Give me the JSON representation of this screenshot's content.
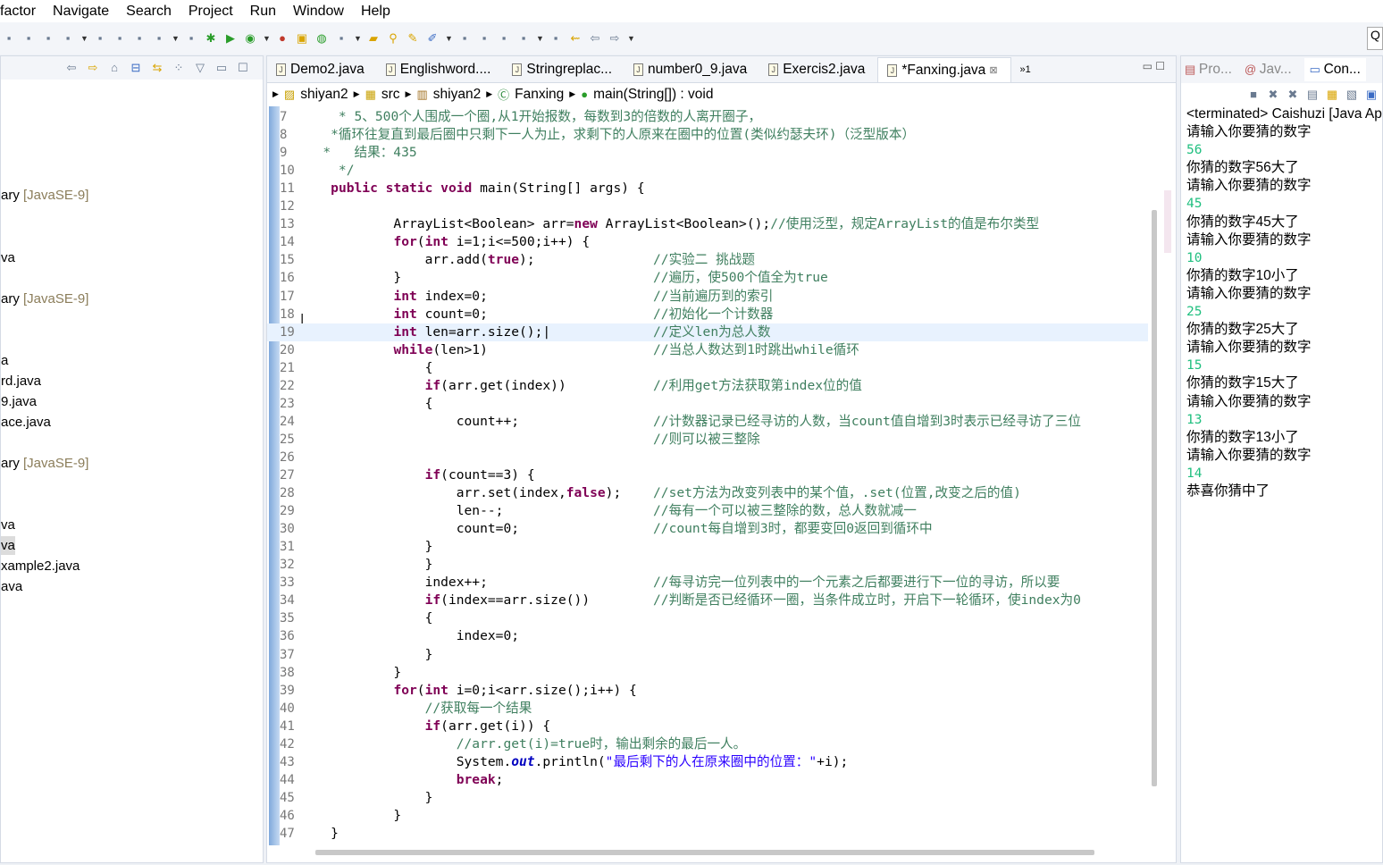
{
  "menu": [
    "factor",
    "Navigate",
    "Search",
    "Project",
    "Run",
    "Window",
    "Help"
  ],
  "toolbar": {
    "icons": [
      "skip-icon",
      "suspend-icon",
      "terminate-icon",
      "disconnect-icon",
      "step-into-icon",
      "step-over-icon",
      "step-return-icon",
      "toggle-icon",
      "build-icon",
      "debug-icon",
      "run-icon",
      "coverage-icon",
      "external-tools-icon",
      "new-package-icon",
      "new-class-icon",
      "open-type-icon",
      "open-folder-icon",
      "search-icon",
      "mark-occurrences-icon",
      "highlight-icon",
      "block-select-icon",
      "whitespace-icon",
      "pilcrow-icon",
      "next-annotation-icon",
      "prev-annotation-icon",
      "last-edit-icon",
      "back-icon",
      "forward-icon"
    ],
    "search_placeholder": "Q"
  },
  "left": {
    "items": [
      {
        "text": "ary ",
        "dec": "[JavaSE-9]"
      },
      {
        "text": "va",
        "dec": ""
      },
      {
        "text": "ary ",
        "dec": "[JavaSE-9]"
      },
      {
        "text": "a",
        "dec": ""
      },
      {
        "text": "rd.java",
        "dec": ""
      },
      {
        "text": "9.java",
        "dec": ""
      },
      {
        "text": "ace.java",
        "dec": ""
      },
      {
        "text": "ary ",
        "dec": "[JavaSE-9]"
      },
      {
        "text": "va",
        "dec": ""
      },
      {
        "text": "va",
        "dec": "",
        "selected": true
      },
      {
        "text": "xample2.java",
        "dec": ""
      },
      {
        "text": "ava",
        "dec": ""
      }
    ]
  },
  "editor": {
    "tabs": [
      {
        "label": "Demo2.java"
      },
      {
        "label": "Englishword...."
      },
      {
        "label": "Stringreplac..."
      },
      {
        "label": "number0_9.java"
      },
      {
        "label": "Exercis2.java"
      },
      {
        "label": "*Fanxing.java",
        "active": true
      }
    ],
    "overflow": "»1",
    "breadcrumb": [
      "shiyan2",
      "src",
      "shiyan2",
      "Fanxing",
      "main(String[]) : void"
    ],
    "current_line": 19,
    "lines": [
      {
        "n": 7,
        "code": [
          [
            "cm",
            "     * 5、500个人围成一个圈,从1开始报数，每数到3的倍数的人离开圈子，"
          ]
        ]
      },
      {
        "n": 8,
        "code": [
          [
            "cm",
            "    *循环往复直到最后圈中只剩下一人为止，求剩下的人原来在圈中的位置(类似约瑟夫环)（泛型版本）"
          ]
        ]
      },
      {
        "n": 9,
        "code": [
          [
            "cm",
            "   *   结果：435"
          ]
        ]
      },
      {
        "n": 10,
        "code": [
          [
            "cm",
            "     */"
          ]
        ]
      },
      {
        "n": 11,
        "code": [
          [
            "p",
            "    "
          ],
          [
            "kw",
            "public static void"
          ],
          [
            "p",
            " main(String[] args) {"
          ]
        ]
      },
      {
        "n": 12,
        "code": []
      },
      {
        "n": 13,
        "code": [
          [
            "p",
            "            ArrayList<Boolean> arr="
          ],
          [
            "kw",
            "new"
          ],
          [
            "p",
            " ArrayList<Boolean>();"
          ],
          [
            "cm",
            "//使用泛型，规定ArrayList的值是布尔类型"
          ]
        ]
      },
      {
        "n": 14,
        "code": [
          [
            "p",
            "            "
          ],
          [
            "kw",
            "for"
          ],
          [
            "p",
            "("
          ],
          [
            "kw",
            "int"
          ],
          [
            "p",
            " i=1;i<=500;i++) {"
          ]
        ]
      },
      {
        "n": 15,
        "code": [
          [
            "p",
            "                arr.add("
          ],
          [
            "kw",
            "true"
          ],
          [
            "p",
            ");"
          ]
        ],
        "comment": "//实验二 挑战题"
      },
      {
        "n": 16,
        "code": [
          [
            "p",
            "            }"
          ]
        ],
        "comment": "//遍历，使500个值全为true"
      },
      {
        "n": 17,
        "code": [
          [
            "p",
            "            "
          ],
          [
            "kw",
            "int"
          ],
          [
            "p",
            " index=0;"
          ]
        ],
        "comment": "//当前遍历到的索引"
      },
      {
        "n": 18,
        "code": [
          [
            "p",
            "            "
          ],
          [
            "kw",
            "int"
          ],
          [
            "p",
            " count=0;"
          ]
        ],
        "comment": "//初始化一个计数器"
      },
      {
        "n": 19,
        "code": [
          [
            "p",
            "            "
          ],
          [
            "kw",
            "int"
          ],
          [
            "p",
            " len=arr.size();|"
          ]
        ],
        "comment": "//定义len为总人数"
      },
      {
        "n": 20,
        "code": [
          [
            "p",
            "            "
          ],
          [
            "kw",
            "while"
          ],
          [
            "p",
            "(len>1)"
          ]
        ],
        "comment": "//当总人数达到1时跳出while循环"
      },
      {
        "n": 21,
        "code": [
          [
            "p",
            "                {"
          ]
        ]
      },
      {
        "n": 22,
        "code": [
          [
            "p",
            "                "
          ],
          [
            "kw",
            "if"
          ],
          [
            "p",
            "(arr.get(index))"
          ]
        ],
        "comment": "//利用get方法获取第index位的值"
      },
      {
        "n": 23,
        "code": [
          [
            "p",
            "                {"
          ]
        ]
      },
      {
        "n": 24,
        "code": [
          [
            "p",
            "                    count++;"
          ]
        ],
        "comment": "//计数器记录已经寻访的人数，当count值自增到3时表示已经寻访了三位"
      },
      {
        "n": 25,
        "code": [],
        "comment": "//则可以被三整除"
      },
      {
        "n": 26,
        "code": []
      },
      {
        "n": 27,
        "code": [
          [
            "p",
            "                "
          ],
          [
            "kw",
            "if"
          ],
          [
            "p",
            "(count==3) {"
          ]
        ]
      },
      {
        "n": 28,
        "code": [
          [
            "p",
            "                    arr.set(index,"
          ],
          [
            "kw",
            "false"
          ],
          [
            "p",
            ");"
          ]
        ],
        "comment": "//set方法为改变列表中的某个值，.set(位置,改变之后的值)"
      },
      {
        "n": 29,
        "code": [
          [
            "p",
            "                    len--;"
          ]
        ],
        "comment": "//每有一个可以被三整除的数，总人数就减一"
      },
      {
        "n": 30,
        "code": [
          [
            "p",
            "                    count=0;"
          ]
        ],
        "comment": "//count每自增到3时，都要变回0返回到循环中"
      },
      {
        "n": 31,
        "code": [
          [
            "p",
            "                }"
          ]
        ]
      },
      {
        "n": 32,
        "code": [
          [
            "p",
            "                }"
          ]
        ]
      },
      {
        "n": 33,
        "code": [
          [
            "p",
            "                index++;"
          ]
        ],
        "comment": "//每寻访完一位列表中的一个元素之后都要进行下一位的寻访，所以要"
      },
      {
        "n": 34,
        "code": [
          [
            "p",
            "                "
          ],
          [
            "kw",
            "if"
          ],
          [
            "p",
            "(index==arr.size())"
          ]
        ],
        "comment": "//判断是否已经循环一圈，当条件成立时，开启下一轮循环，使index为0"
      },
      {
        "n": 35,
        "code": [
          [
            "p",
            "                {"
          ]
        ]
      },
      {
        "n": 36,
        "code": [
          [
            "p",
            "                    index=0;"
          ]
        ]
      },
      {
        "n": 37,
        "code": [
          [
            "p",
            "                }"
          ]
        ]
      },
      {
        "n": 38,
        "code": [
          [
            "p",
            "            }"
          ]
        ]
      },
      {
        "n": 39,
        "code": [
          [
            "p",
            "            "
          ],
          [
            "kw",
            "for"
          ],
          [
            "p",
            "("
          ],
          [
            "kw",
            "int"
          ],
          [
            "p",
            " i=0;i<arr.size();i++) {"
          ]
        ]
      },
      {
        "n": 40,
        "code": [
          [
            "p",
            "                "
          ],
          [
            "cm",
            "//获取每一个结果"
          ]
        ]
      },
      {
        "n": 41,
        "code": [
          [
            "p",
            "                "
          ],
          [
            "kw",
            "if"
          ],
          [
            "p",
            "(arr.get(i)) {"
          ]
        ]
      },
      {
        "n": 42,
        "code": [
          [
            "p",
            "                    "
          ],
          [
            "cm",
            "//arr.get(i)=true时，输出剩余的最后一人。"
          ]
        ]
      },
      {
        "n": 43,
        "code": [
          [
            "p",
            "                    System."
          ],
          [
            "fld",
            "out"
          ],
          [
            "p",
            ".println("
          ],
          [
            "str",
            "\"最后剩下的人在原来圈中的位置：\""
          ],
          [
            "p",
            "+i);"
          ]
        ]
      },
      {
        "n": 44,
        "code": [
          [
            "p",
            "                    "
          ],
          [
            "kw",
            "break"
          ],
          [
            "p",
            ";"
          ]
        ]
      },
      {
        "n": 45,
        "code": [
          [
            "p",
            "                }"
          ]
        ]
      },
      {
        "n": 46,
        "code": [
          [
            "p",
            "            }"
          ]
        ]
      },
      {
        "n": 47,
        "code": [
          [
            "p",
            "    }"
          ]
        ]
      }
    ]
  },
  "right": {
    "tabs": [
      "Pro...",
      "Jav...",
      "Con..."
    ],
    "header": "<terminated> Caishuzi [Java Ap",
    "console": [
      {
        "t": "请输入你要猜的数字"
      },
      {
        "t": "56",
        "input": true
      },
      {
        "t": "你猜的数字56大了"
      },
      {
        "t": "请输入你要猜的数字"
      },
      {
        "t": "45",
        "input": true
      },
      {
        "t": "你猜的数字45大了"
      },
      {
        "t": "请输入你要猜的数字"
      },
      {
        "t": "10",
        "input": true
      },
      {
        "t": "你猜的数字10小了"
      },
      {
        "t": "请输入你要猜的数字"
      },
      {
        "t": "25",
        "input": true
      },
      {
        "t": "你猜的数字25大了"
      },
      {
        "t": "请输入你要猜的数字"
      },
      {
        "t": "15",
        "input": true
      },
      {
        "t": "你猜的数字15大了"
      },
      {
        "t": "请输入你要猜的数字"
      },
      {
        "t": "13",
        "input": true
      },
      {
        "t": "你猜的数字13小了"
      },
      {
        "t": "请输入你要猜的数字"
      },
      {
        "t": "14",
        "input": true
      },
      {
        "t": "恭喜你猜中了"
      }
    ]
  },
  "colors": {
    "keyword": "#7f0055",
    "comment": "#3f7f5f",
    "string": "#2a00ff",
    "console_input": "#1fbf7f",
    "current_line": "#e8f2fe"
  }
}
